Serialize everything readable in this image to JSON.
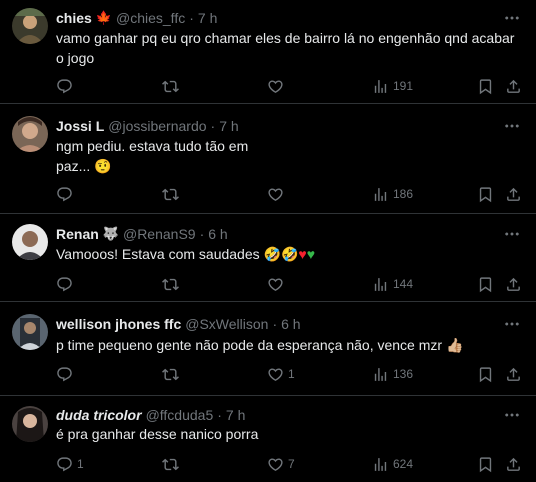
{
  "posts": [
    {
      "name": "chies",
      "name_emoji": "🍁",
      "handle": "@chies_ffc",
      "separator": "·",
      "time": "7 h",
      "text": "vamo ganhar pq eu qro chamar eles de bairro lá no engenhão qnd acabar o jogo",
      "replies": "",
      "reposts": "",
      "likes": "",
      "views": "191"
    },
    {
      "name": "Jossi L",
      "handle": "@jossibernardo",
      "separator": "·",
      "time": "7 h",
      "text_line1": "ngm pediu. estava tudo tão em",
      "text_line2": "paz...",
      "text_emoji": "🤨",
      "replies": "",
      "reposts": "",
      "likes": "",
      "views": "186"
    },
    {
      "name": "Renan",
      "name_emoji": "🐺",
      "handle": "@RenanS9",
      "separator": "·",
      "time": "6 h",
      "text": "Vamooos! Estava com saudades",
      "text_emojis": [
        "🤣",
        "🤣",
        "♥",
        "♥"
      ],
      "replies": "",
      "reposts": "",
      "likes": "",
      "views": "144"
    },
    {
      "name": "wellison jhones ffc",
      "handle": "@SxWellison",
      "separator": "·",
      "time": "6 h",
      "text": "p time pequeno gente não pode da esperança não, vence mzr",
      "text_emoji": "👍🏼",
      "replies": "",
      "reposts": "",
      "likes": "1",
      "views": "136"
    },
    {
      "name": "duda tricolor",
      "handle": "@ffcduda5",
      "separator": "·",
      "time": "7 h",
      "text": "é pra ganhar desse nanico porra",
      "replies": "1",
      "reposts": "",
      "likes": "7",
      "views": "624"
    }
  ],
  "colors": {
    "background": "#000000",
    "text": "#e7e9ea",
    "secondary": "#71767b",
    "divider": "#2f3336"
  },
  "icons": {
    "reply": "speech-bubble-icon",
    "repost": "repost-arrows-icon",
    "like": "heart-outline-icon",
    "views": "bar-chart-icon",
    "bookmark": "bookmark-icon",
    "share": "share-upload-icon",
    "more": "more-dots-icon"
  }
}
